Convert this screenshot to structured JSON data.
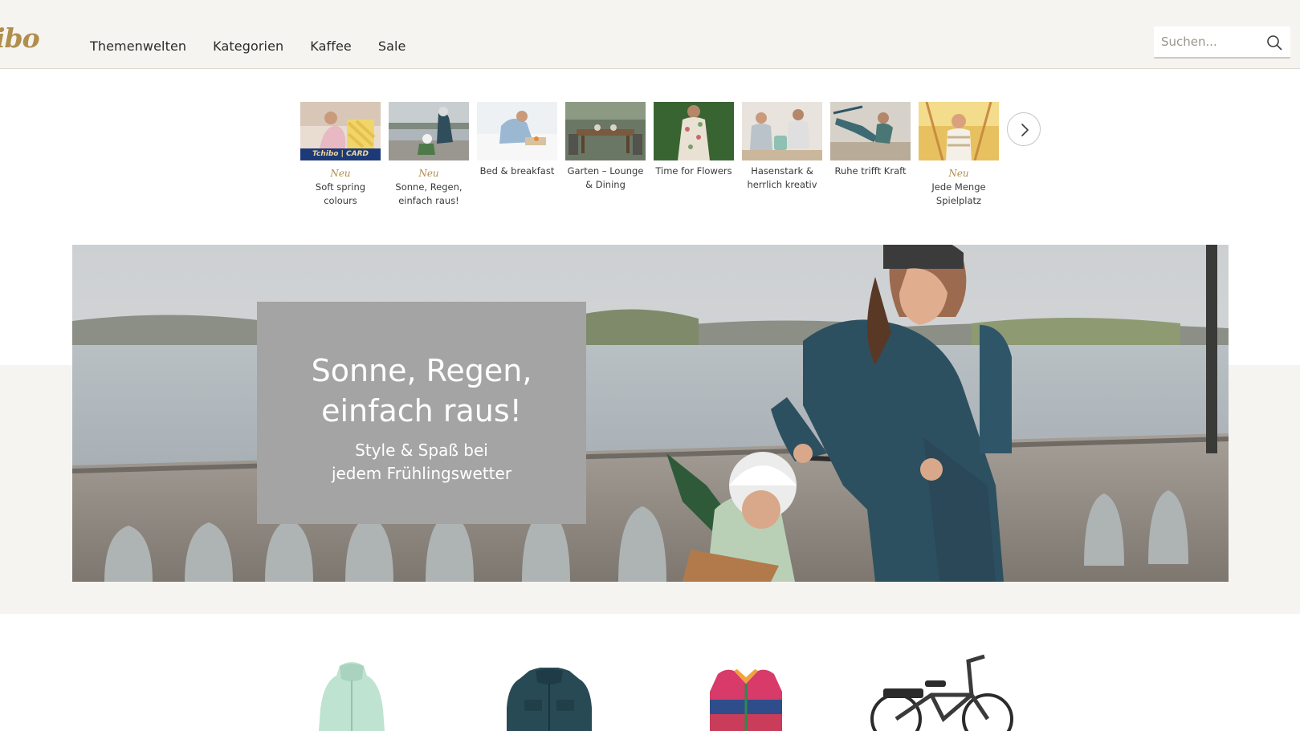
{
  "header": {
    "logo_text": "ibo",
    "nav": [
      "Themenwelten",
      "Kategorien",
      "Kaffee",
      "Sale"
    ],
    "search_placeholder": "Suchen..."
  },
  "themes": [
    {
      "badge": "Neu",
      "label": "Soft spring colours",
      "card_text": "Tchibo | CARD"
    },
    {
      "badge": "Neu",
      "label": "Sonne, Regen, einfach raus!"
    },
    {
      "badge": "",
      "label": "Bed & breakfast"
    },
    {
      "badge": "",
      "label": "Garten – Lounge & Dining"
    },
    {
      "badge": "",
      "label": "Time for Flowers"
    },
    {
      "badge": "",
      "label": "Hasenstark & herrlich kreativ"
    },
    {
      "badge": "",
      "label": "Ruhe trifft Kraft"
    },
    {
      "badge": "Neu",
      "label": "Jede Menge Spielplatz"
    }
  ],
  "hero": {
    "title_line1": "Sonne, Regen,",
    "title_line2": "einfach raus!",
    "sub_line1": "Style & Spaß bei",
    "sub_line2": "jedem Frühlingswetter"
  },
  "colors": {
    "accent_gold": "#b08e4c",
    "header_bg": "#f6f4f0",
    "hero_box": "#a3a4a3"
  },
  "icons": {
    "search": "search-icon",
    "next": "chevron-right-icon"
  }
}
